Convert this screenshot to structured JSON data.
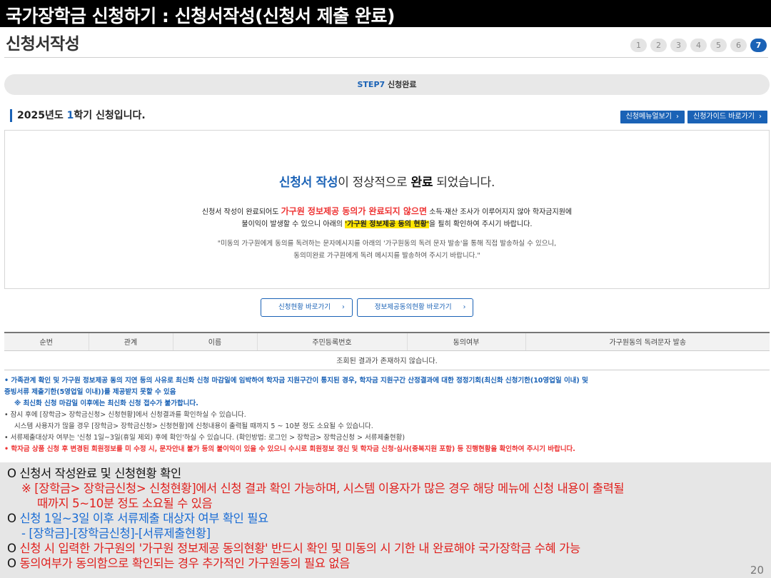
{
  "slide_title": "국가장학금 신청하기 : 신청서작성(신청서 제출 완료)",
  "page_title": "신청서작성",
  "steps": [
    "1",
    "2",
    "3",
    "4",
    "5",
    "6",
    "7"
  ],
  "active_step": "7",
  "step_bar": {
    "step": "STEP7",
    "label": "신청완료"
  },
  "semester": {
    "year": "2025",
    "year_suffix": "년도 ",
    "term": "1",
    "term_suffix": "학기 신청입니다."
  },
  "top_buttons": {
    "manual": "신청메뉴얼보기",
    "guide": "신청가이드 바로가기"
  },
  "message": {
    "main_a": "신청서 작성",
    "main_b": "이 정상적으로 ",
    "main_c": "완료",
    "main_d": " 되었습니다.",
    "line1_a": "신청서 작성이 완료되어도 ",
    "line1_red": "가구원 정보제공 동의가 완료되지 않으면",
    "line1_b": " 소득·재산 조사가 이루어지지 않아 학자금지원에",
    "line2_a": "불이익이 발생할 수 있으니 아래의 ",
    "line2_hl": "'가구원 정보제공 동의 현황'",
    "line2_b": "을 필히 확인하여 주시기 바랍니다.",
    "note1": "\"미동의 가구원에게 동의를 독려하는 문자메시지를 아래의 '가구원동의 독려 문자 발송'을 통해 직접 발송하실 수 있으니,",
    "note2": "동의미완료 가구원에게 독려 메시지를 발송하여 주시기 바랍니다.\""
  },
  "mid_buttons": {
    "status": "신청현황 바로가기",
    "consent": "정보제공동의현황 바로가기"
  },
  "table": {
    "headers": [
      "순번",
      "관계",
      "이름",
      "주민등록번호",
      "동의여부",
      "가구원동의 독려문자 발송"
    ],
    "empty_message": "조회된 결과가 존재하지 않습니다."
  },
  "notes": {
    "n1": "• 가족관계 확인 및 가구원 정보제공 동의 지연 등의 사유로 최신화 신청 마감일에 임박하여 학자금 지원구간이 통지된 경우, 학자금 지원구간 산정결과에 대한 정정기회(최신화 신청기한(10영업일 이내) 및",
    "n1b": "증빙서류 제출기한(5영업일 이내))를 제공받지 못할 수 있음",
    "n1c": "※ 최신화 신청 마감일 이후에는 최신화 신청 접수가 불가합니다.",
    "n2": "• 잠시 후에 [장학금> 장학금신청> 신청현황]에서 신청결과를 확인하실 수 있습니다.",
    "n2b": "시스템 사용자가 많을 경우 [장학금> 장학금신청> 신청현황]에 신청내용이 출력될 때까지 5 ~ 10분 정도 소요될 수 있습니다.",
    "n3": "• 서류제출대상자 여부는 '신청 1일~3일(휴일 제외) 후에 확인'하실 수 있습니다. (확인방법: 로그인 > 장학금> 장학금신청 > 서류제출현황)",
    "n4": "• 학자금 상품 신청 후 변경된 회원정보를 미 수정 시, 문자안내 불가 등의 불이익이 있을 수 있으니 수시로 회원정보 갱신 및 학자금 신청·심사(중복지원 포함) 등 진행현황을 확인하여 주시기 바랍니다."
  },
  "summary": {
    "s1": "O 신청서 작성완료 및 신청현황 확인",
    "s2": "※ [장학금> 장학금신청> 신청현황]에서 신청 결과 확인 가능하며, 시스템 이용자가 많은 경우 해당 메뉴에 신청 내용이 출력될",
    "s3": "때까지 5~10분 정도 소요될 수 있음",
    "s4a": "O ",
    "s4b": "신청 1일~3일 이후 서류제출 대상자 여부 확인 필요",
    "s5": "- [장학금]-[장학금신청]-[서류제출현황]",
    "s6a": "O ",
    "s6b": "신청 시 입력한 가구원의 '가구원 정보제공 동의현황' 반드시 확인 및 미동의 시 기한 내 완료해야 국가장학금 수혜 가능",
    "s7a": "O ",
    "s7b": "동의여부가 동의함으로 확인되는 경우 추가적인 가구원동의 필요 없음"
  },
  "page_number": "20"
}
